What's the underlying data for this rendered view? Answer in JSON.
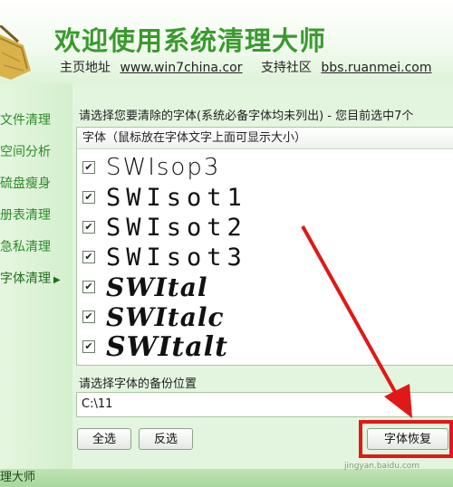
{
  "header": {
    "title": "欢迎使用系统清理大师",
    "home_label": "主页地址",
    "home_link": "www.win7china.cor",
    "support_label": "支持社区",
    "support_link": "bbs.ruanmei.com"
  },
  "sidebar": {
    "items": [
      {
        "label": "文件清理"
      },
      {
        "label": "空间分析"
      },
      {
        "label": "硫盘瘦身"
      },
      {
        "label": "册表清理"
      },
      {
        "label": "急私清理"
      },
      {
        "label": "字体清理",
        "active": true
      }
    ]
  },
  "main": {
    "prompt": "请选择您要清除的字体(系统必备字体均未列出) - 您目前选中7个",
    "list_header": "字体（鼠标放在字体文字上面可显示大小）",
    "fonts": [
      {
        "name": "SWIsop3",
        "checked": true
      },
      {
        "name": "SWIsot1",
        "checked": true
      },
      {
        "name": "SWIsot2",
        "checked": true
      },
      {
        "name": "SWIsot3",
        "checked": true
      },
      {
        "name": "SWItal",
        "checked": true
      },
      {
        "name": "SWItalc",
        "checked": true
      },
      {
        "name": "SWItalt",
        "checked": true
      }
    ],
    "backup_prompt": "请选择字体的备份位置",
    "backup_path": "C:\\11",
    "buttons": {
      "select_all": "全选",
      "invert": "反选",
      "restore": "字体恢复"
    }
  },
  "statusbar": {
    "text": "理大师"
  },
  "watermark": "jingyan.baidu.com",
  "colors": {
    "title_green": "#3a9a2e",
    "annotation_red": "#e01818"
  }
}
